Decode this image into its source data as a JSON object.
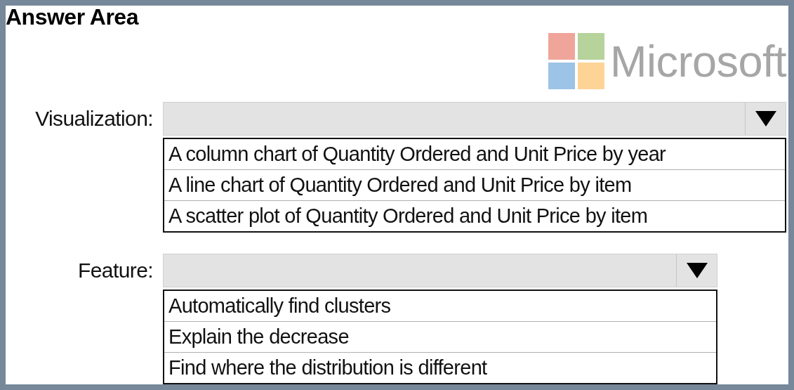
{
  "title": "Answer Area",
  "logo": {
    "text": "Microsoft"
  },
  "dropdowns": [
    {
      "label": "Visualization:",
      "options": [
        "A column chart of Quantity Ordered and Unit Price by year",
        "A line chart of Quantity Ordered and Unit Price by item",
        "A scatter plot of Quantity Ordered and Unit Price by item"
      ]
    },
    {
      "label": "Feature:",
      "options": [
        "Automatically find clusters",
        "Explain the decrease",
        "Find where the distribution is different"
      ]
    }
  ]
}
